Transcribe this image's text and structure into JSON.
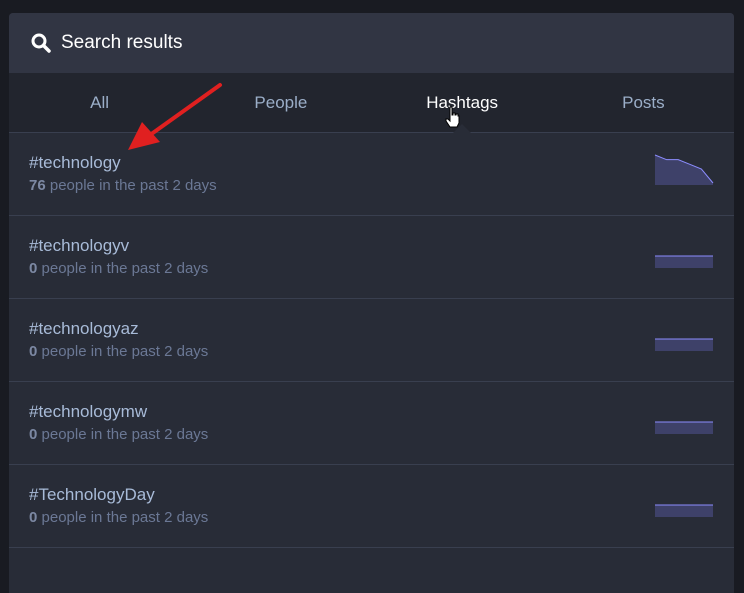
{
  "header": {
    "title": "Search results",
    "icon": "search-icon"
  },
  "tabs": [
    {
      "label": "All",
      "active": false
    },
    {
      "label": "People",
      "active": false
    },
    {
      "label": "Hashtags",
      "active": true
    },
    {
      "label": "Posts",
      "active": false
    }
  ],
  "results": [
    {
      "name": "#technology",
      "count": "76",
      "suffix": " people in the past 2 days",
      "trend": [
        6,
        5,
        5,
        4,
        3,
        0
      ]
    },
    {
      "name": "#technologyv",
      "count": "0",
      "suffix": " people in the past 2 days",
      "trend": [
        0,
        0,
        0,
        0,
        0,
        0
      ]
    },
    {
      "name": "#technologyaz",
      "count": "0",
      "suffix": " people in the past 2 days",
      "trend": [
        0,
        0,
        0,
        0,
        0,
        0
      ]
    },
    {
      "name": "#technologymw",
      "count": "0",
      "suffix": " people in the past 2 days",
      "trend": [
        0,
        0,
        0,
        0,
        0,
        0
      ]
    },
    {
      "name": "#TechnologyDay",
      "count": "0",
      "suffix": " people in the past 2 days",
      "trend": [
        0,
        0,
        0,
        0,
        0,
        0
      ]
    }
  ],
  "colors": {
    "accent": "#e02020",
    "sparkline_fill": "#3e4169",
    "sparkline_stroke": "#8c8dff"
  }
}
